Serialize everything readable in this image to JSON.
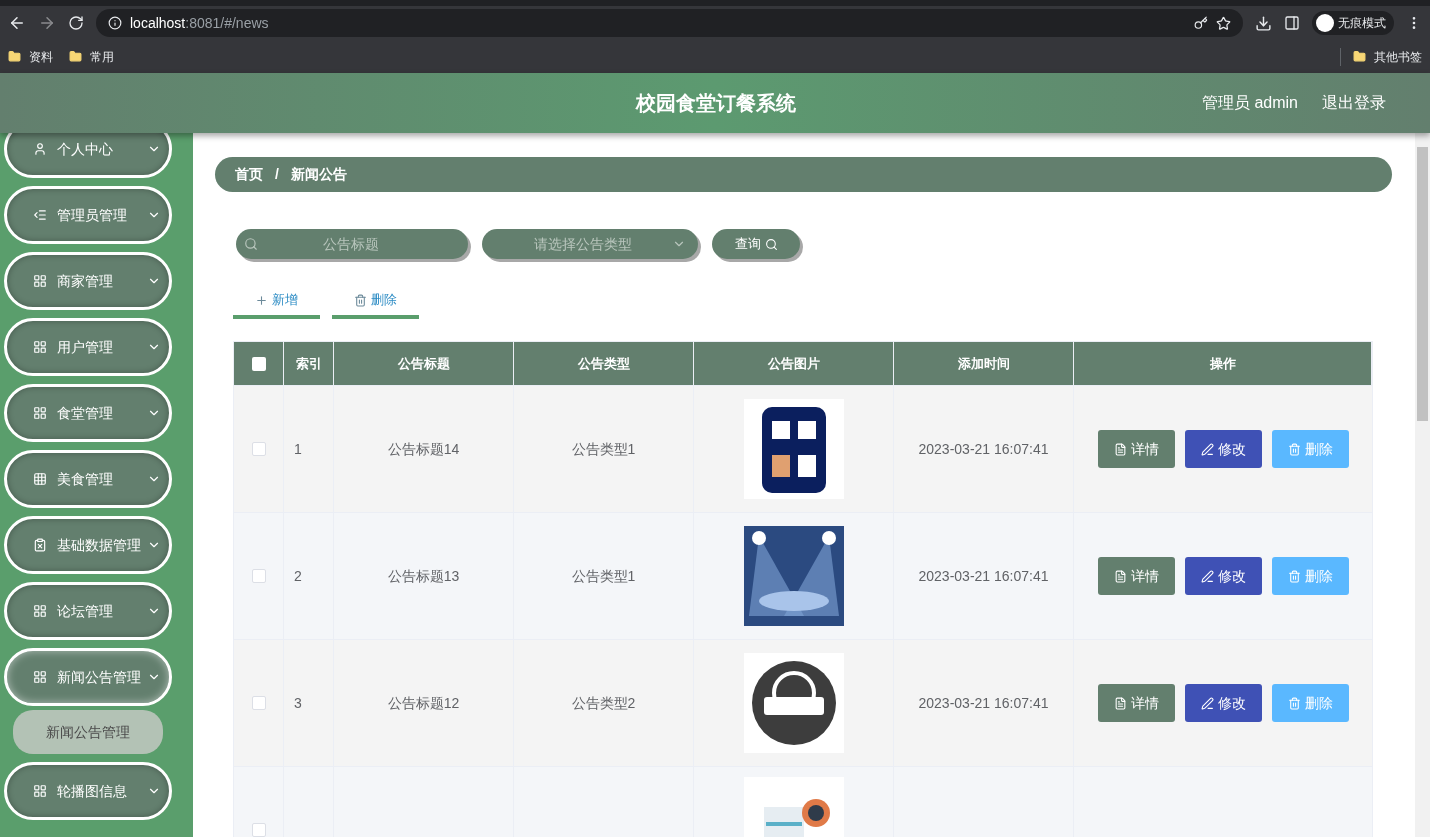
{
  "browser": {
    "url_host": "localhost",
    "url_rest": ":8081/#/news",
    "incognito_label": "无痕模式",
    "bookmarks": [
      "资料",
      "常用"
    ],
    "other_bookmarks": "其他书签"
  },
  "header": {
    "title": "校园食堂订餐系统",
    "user": "管理员 admin",
    "logout": "退出登录"
  },
  "sidebar": {
    "items": [
      {
        "label": "个人中心",
        "expanded": false
      },
      {
        "label": "管理员管理",
        "expanded": false
      },
      {
        "label": "商家管理",
        "expanded": false
      },
      {
        "label": "用户管理",
        "expanded": false
      },
      {
        "label": "食堂管理",
        "expanded": false
      },
      {
        "label": "美食管理",
        "expanded": false
      },
      {
        "label": "基础数据管理",
        "expanded": false
      },
      {
        "label": "论坛管理",
        "expanded": false
      },
      {
        "label": "新闻公告管理",
        "expanded": true,
        "children": [
          {
            "label": "新闻公告管理",
            "selected": true
          }
        ]
      },
      {
        "label": "轮播图信息",
        "expanded": false
      }
    ]
  },
  "breadcrumb": {
    "items": [
      "首页",
      "新闻公告"
    ],
    "separator": "/"
  },
  "search": {
    "title_placeholder": "公告标题",
    "type_placeholder": "请选择公告类型",
    "query_button": "查询"
  },
  "actions": [
    "新增",
    "删除"
  ],
  "table": {
    "all_checked": false,
    "columns": [
      "索引",
      "公告标题",
      "公告类型",
      "公告图片",
      "添加时间",
      "操作"
    ],
    "rows": [
      {
        "index": "1",
        "title": "公告标题14",
        "type": "公告类型1",
        "time": "2023-03-21 16:07:41",
        "checked": false,
        "buttons": [
          "详情",
          "修改",
          "删除"
        ]
      },
      {
        "index": "2",
        "title": "公告标题13",
        "type": "公告类型1",
        "time": "2023-03-21 16:07:41",
        "checked": false,
        "buttons": [
          "详情",
          "修改",
          "删除"
        ]
      },
      {
        "index": "3",
        "title": "公告标题12",
        "type": "公告类型2",
        "time": "2023-03-21 16:07:41",
        "checked": false,
        "buttons": [
          "详情",
          "修改",
          "删除"
        ]
      },
      {
        "checked": false
      }
    ]
  }
}
